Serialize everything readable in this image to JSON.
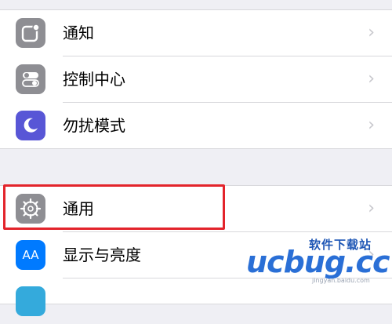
{
  "settings_group1": [
    {
      "label": "通知",
      "icon": "notifications-icon",
      "icon_color": "#8e8e93"
    },
    {
      "label": "控制中心",
      "icon": "control-center-icon",
      "icon_color": "#8e8e93"
    },
    {
      "label": "勿扰模式",
      "icon": "moon-icon",
      "icon_color": "#5856d6"
    }
  ],
  "settings_group2": [
    {
      "label": "通用",
      "icon": "gear-icon",
      "icon_color": "#8e8e93"
    },
    {
      "label": "显示与亮度",
      "icon": "display-brightness-icon",
      "icon_color": "#007aff",
      "icon_text": "AA"
    }
  ],
  "watermark": {
    "top_text": "软件下载站",
    "logo_text": "ucbug.cc",
    "sub_text": "jingyan.baidu.com"
  },
  "colors": {
    "highlight": "#e3242b",
    "chevron": "#c7c7cc",
    "background": "#efeff4"
  }
}
